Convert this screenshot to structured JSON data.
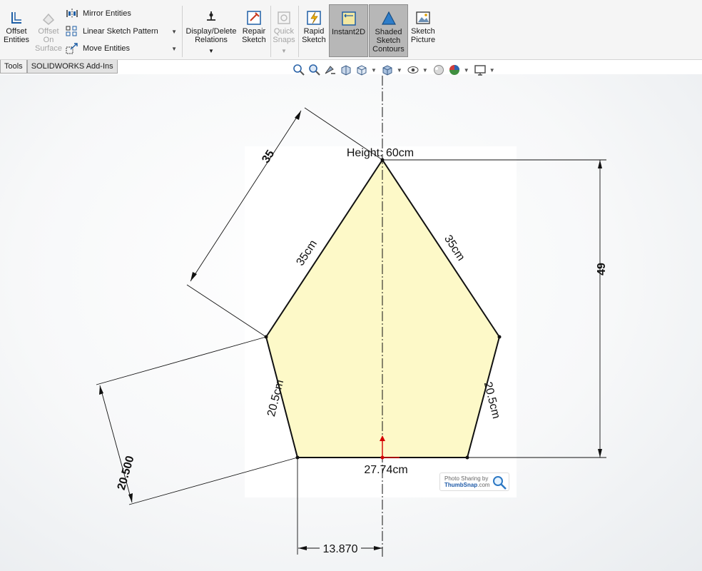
{
  "ribbon": {
    "offset_entities": "Offset\nEntities",
    "offset_on_surface": "Offset\nOn\nSurface",
    "mirror_entities": "Mirror Entities",
    "linear_sketch_pattern": "Linear Sketch Pattern",
    "move_entities": "Move Entities",
    "display_delete_relations": "Display/Delete\nRelations",
    "repair_sketch": "Repair\nSketch",
    "quick_snaps": "Quick\nSnaps",
    "rapid_sketch": "Rapid\nSketch",
    "instant2d": "Instant2D",
    "shaded_sketch_contours": "Shaded\nSketch\nContours",
    "sketch_picture": "Sketch\nPicture"
  },
  "tabs": [
    "Tools",
    "SOLIDWORKS Add-Ins"
  ],
  "annotations": {
    "height": "Height: 60cm",
    "side_left_upper": "35cm",
    "side_right_upper": "35cm",
    "side_left_lower": "20.5cm",
    "side_right_lower": "20.5cm",
    "base": "27.74cm"
  },
  "dimensions": {
    "upper_left_edge": "35",
    "lower_left_edge": "20.500",
    "vertical_height": "49",
    "half_base": "13.870"
  },
  "watermark": {
    "line1": "Photo Sharing by",
    "line2": "ThumbSnap",
    "line2_suffix": ".com"
  },
  "colors": {
    "pentagon_fill": "#fdf9c8",
    "sketch_line": "#111111",
    "origin_red": "#d40000",
    "active_button": "#b7b7b7"
  }
}
